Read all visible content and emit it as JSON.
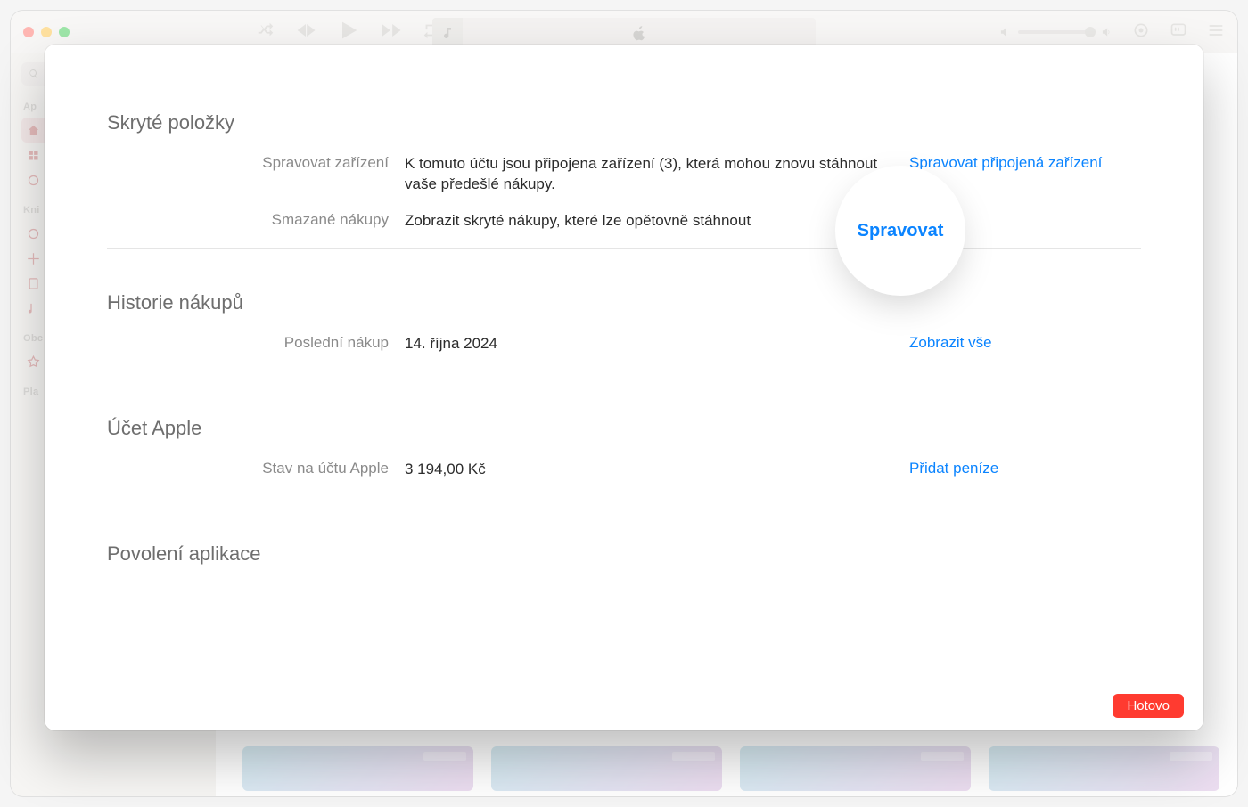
{
  "sidebar": {
    "search_placeholder": " ",
    "sections": [
      {
        "head": "Ap"
      },
      {
        "head": "Kni"
      },
      {
        "head": "Obc"
      },
      {
        "head": "Pla"
      }
    ]
  },
  "modal": {
    "sections": {
      "hidden_items": {
        "title": "Skryté položky",
        "rows": [
          {
            "label": "Spravovat zařízení",
            "value": "K tomuto účtu jsou připojena zařízení (3), která mohou znovu stáhnout vaše předešlé nákupy.",
            "action": "Spravovat připojená zařízení"
          },
          {
            "label": "Smazané nákupy",
            "value": "Zobrazit skryté nákupy, které lze opětovně stáhnout",
            "action": "Spravovat"
          }
        ]
      },
      "purchase_history": {
        "title": "Historie nákupů",
        "rows": [
          {
            "label": "Poslední nákup",
            "value": "14. října 2024",
            "action": "Zobrazit vše"
          }
        ]
      },
      "apple_account": {
        "title": "Účet Apple",
        "rows": [
          {
            "label": "Stav na účtu Apple",
            "value": "3 194,00 Kč",
            "action": "Přidat peníze"
          }
        ]
      },
      "app_permissions": {
        "title": "Povolení aplikace"
      }
    },
    "spotlight_label": "Spravovat",
    "done_button": "Hotovo"
  }
}
